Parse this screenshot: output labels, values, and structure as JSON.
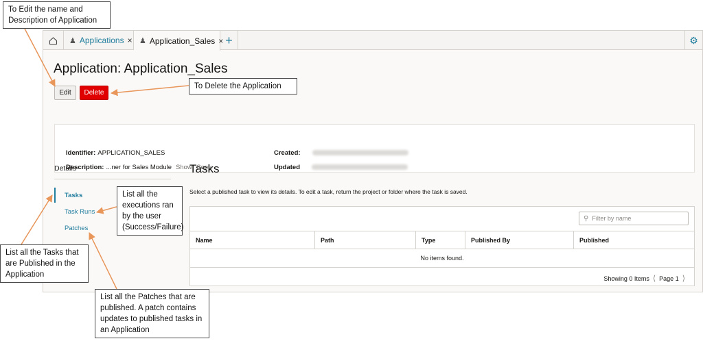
{
  "tabs": {
    "applications_label": "Applications",
    "active_label": "Application_Sales",
    "close_glyph": "×",
    "add_glyph": "+"
  },
  "page": {
    "title": "Application: Application_Sales",
    "edit_label": "Edit",
    "delete_label": "Delete"
  },
  "info": {
    "identifier_label": "Identifier:",
    "identifier_value": "APPLICATION_SALES",
    "description_label": "Description:",
    "description_value": "...ner for Sales Module",
    "show_label": "Show",
    "copy_label": "Copy",
    "created_label": "Created:",
    "updated_label": "Updated"
  },
  "sidebar": {
    "header": "Details",
    "items": [
      {
        "label": "Tasks"
      },
      {
        "label": "Task Runs"
      },
      {
        "label": "Patches"
      }
    ]
  },
  "tasks": {
    "title": "Tasks",
    "description": "Select a published task to view its details. To edit a task, return the project or folder where the task is saved.",
    "filter_placeholder": "Filter by name",
    "columns": [
      "Name",
      "Path",
      "Type",
      "Published By",
      "Published"
    ],
    "empty_text": "No items found.",
    "showing_text": "Showing 0 Items",
    "page_text": "Page 1"
  },
  "callouts": {
    "edit": "To Edit the name and Description of Application",
    "delete": "To Delete the Application",
    "task_runs": "List all the executions ran by the user (Success/Failure)",
    "tasks": "List all the Tasks that are Published in the Application",
    "patches": "List all the Patches that are published. A patch contains updates to published tasks in an Application"
  },
  "colors": {
    "accent": "#227e9e",
    "delete": "#e00000",
    "arrow": "#e8965a"
  },
  "icons": [
    "home-icon",
    "person-icon",
    "close-icon",
    "add-icon",
    "gear-icon",
    "search-icon",
    "chevron-left-icon",
    "chevron-right-icon"
  ]
}
